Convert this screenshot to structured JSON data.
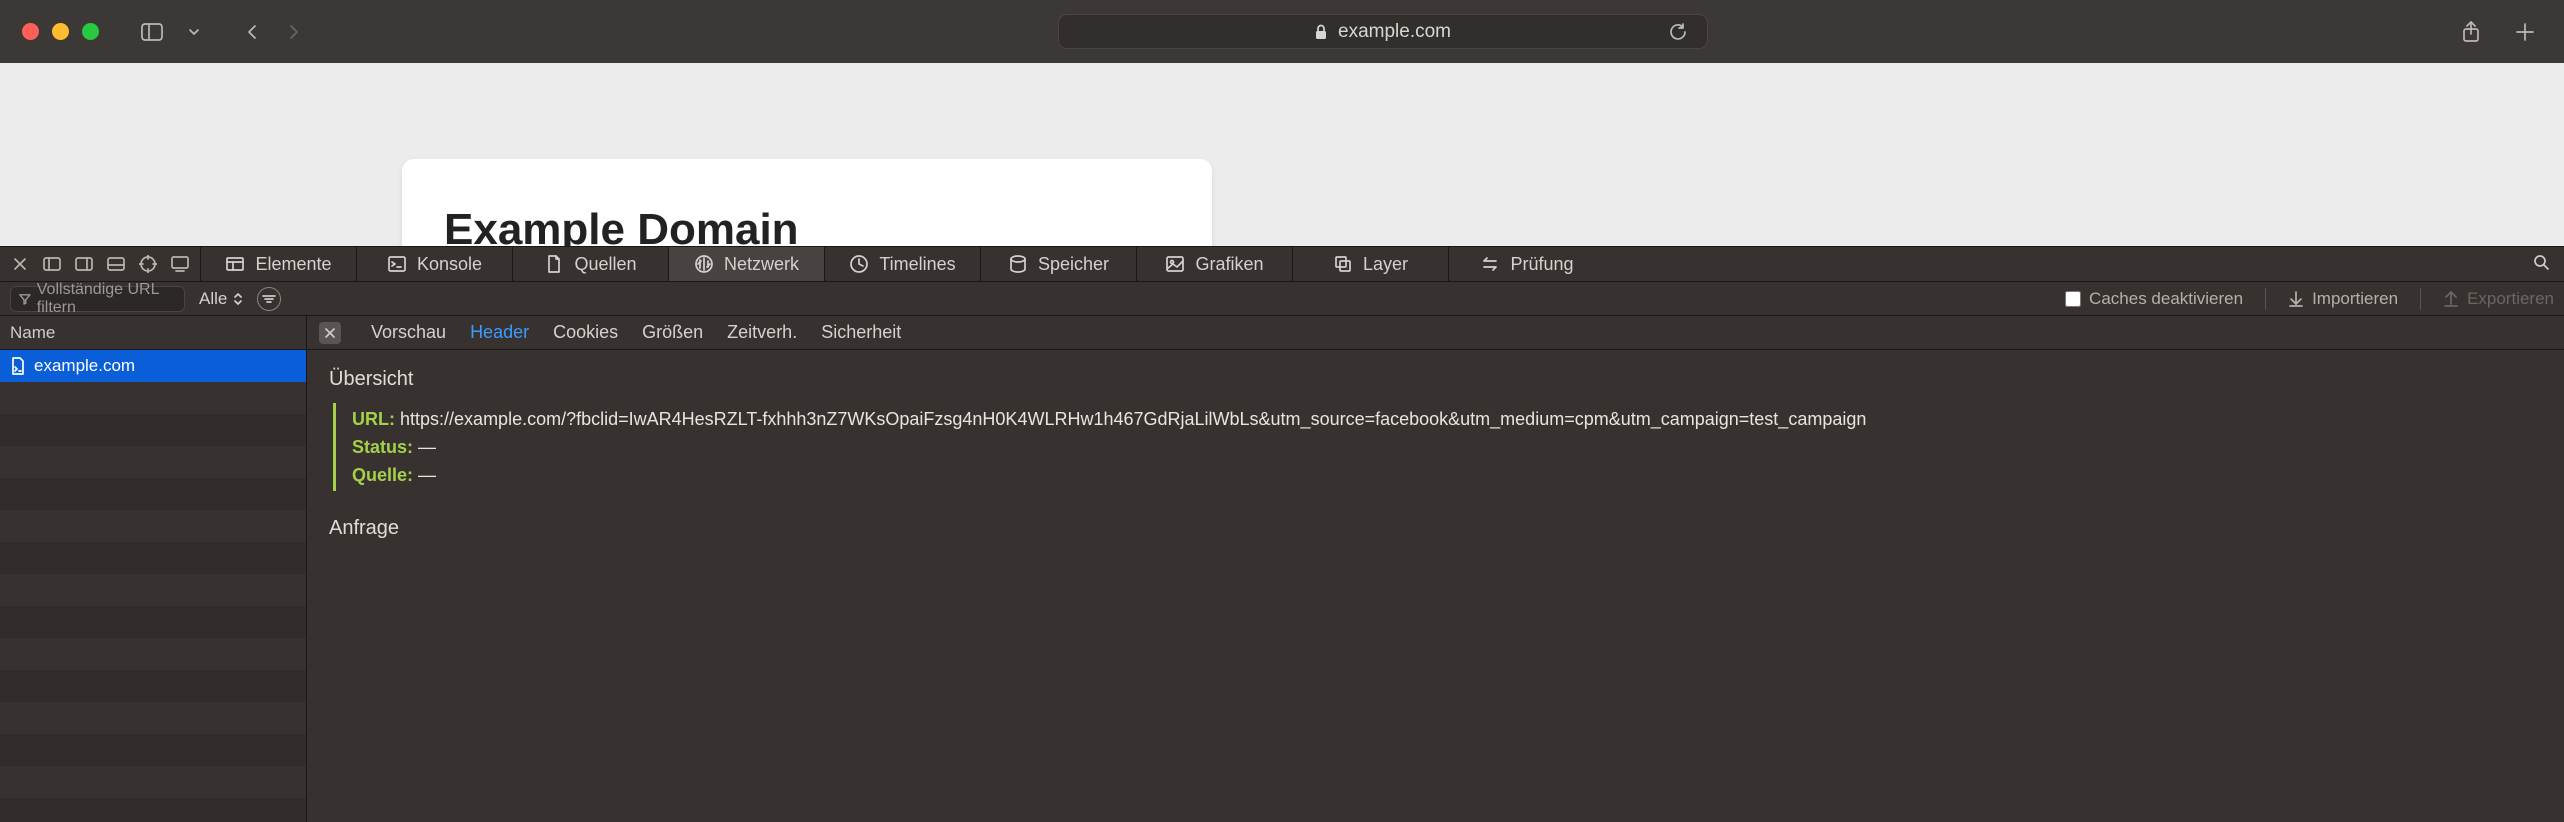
{
  "toolbar": {
    "domain": "example.com"
  },
  "page": {
    "heading": "Example Domain"
  },
  "devtools": {
    "tabs": {
      "elements": "Elemente",
      "console": "Konsole",
      "sources": "Quellen",
      "network": "Netzwerk",
      "timelines": "Timelines",
      "storage": "Speicher",
      "graphics": "Grafiken",
      "layers": "Layer",
      "audit": "Prüfung"
    },
    "filter": {
      "placeholder": "Vollständige URL filtern",
      "all": "Alle",
      "disable_caches": "Caches deaktivieren",
      "import": "Importieren",
      "export": "Exportieren"
    },
    "sidebar": {
      "header": "Name",
      "items": [
        "example.com"
      ]
    },
    "detail_tabs": {
      "preview": "Vorschau",
      "headers": "Header",
      "cookies": "Cookies",
      "sizes": "Größen",
      "timing": "Zeitverh.",
      "security": "Sicherheit"
    },
    "overview": {
      "title": "Übersicht",
      "url_label": "URL:",
      "url_value": "https://example.com/?fbclid=IwAR4HesRZLT-fxhhh3nZ7WKsOpaiFzsg4nH0K4WLRHw1h467GdRjaLilWbLs&utm_source=facebook&utm_medium=cpm&utm_campaign=test_campaign",
      "status_label": "Status:",
      "status_value": "—",
      "source_label": "Quelle:",
      "source_value": "—"
    },
    "request": {
      "title": "Anfrage"
    }
  }
}
